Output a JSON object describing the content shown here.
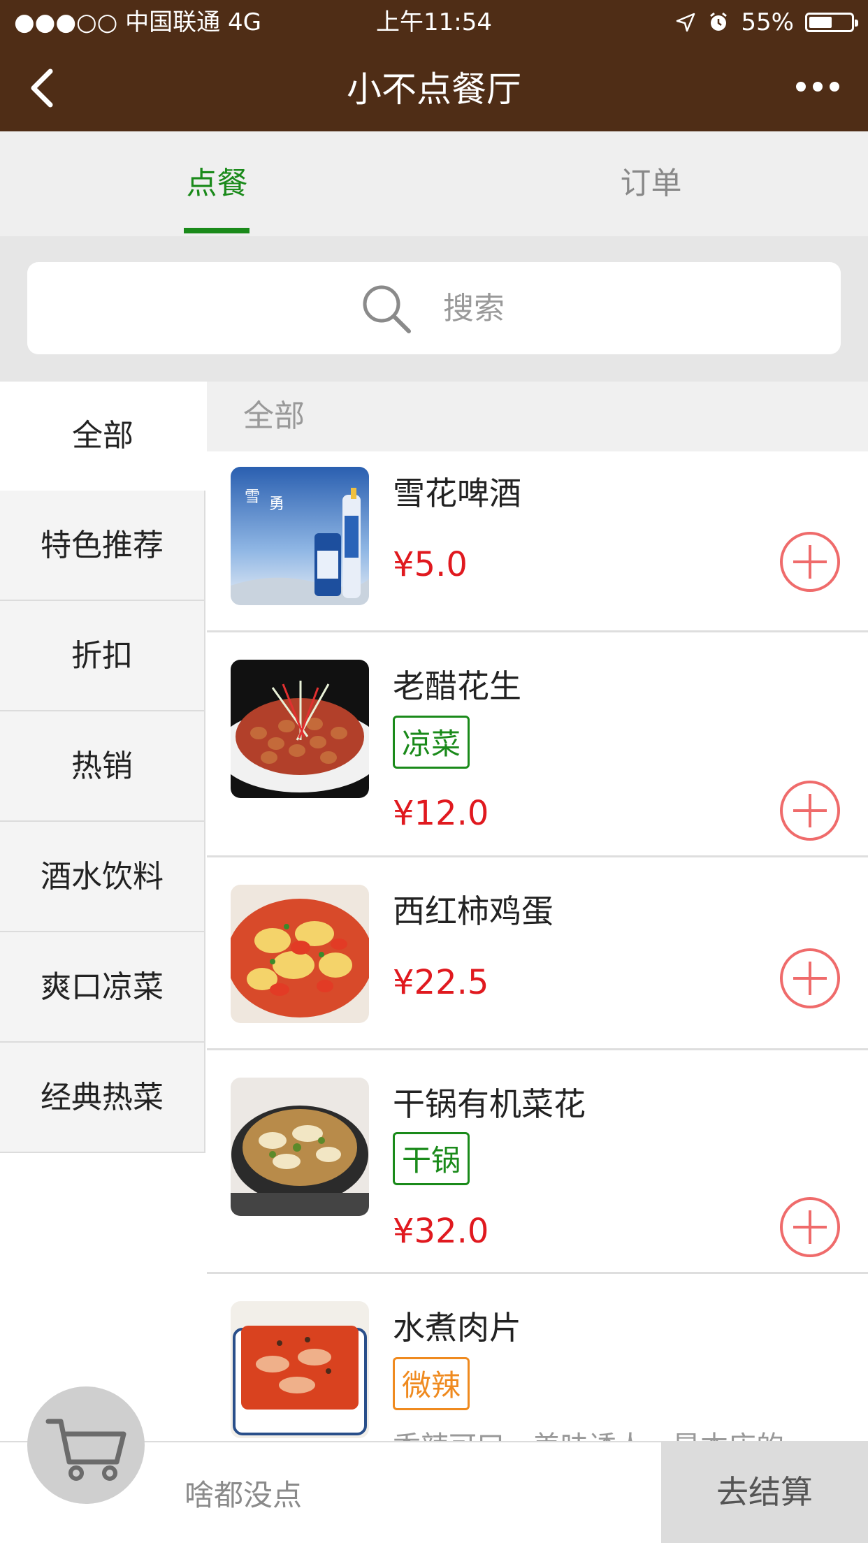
{
  "status_bar": {
    "carrier": "●●●○○ 中国联通   4G",
    "time": "上午11:54",
    "battery": "55%",
    "battery_level": 0.55
  },
  "nav": {
    "title": "小不点餐厅",
    "back_icon": "chevron-left-icon",
    "more_icon": "more-dots-icon"
  },
  "tabs": [
    {
      "label": "点餐",
      "active": true
    },
    {
      "label": "订单",
      "active": false
    }
  ],
  "search": {
    "placeholder": "搜索",
    "icon": "search-icon"
  },
  "categories": [
    {
      "label": "全部",
      "active": true
    },
    {
      "label": "特色推荐"
    },
    {
      "label": "折扣"
    },
    {
      "label": "热销"
    },
    {
      "label": "酒水饮料"
    },
    {
      "label": "爽口凉菜"
    },
    {
      "label": "经典热菜"
    }
  ],
  "list": {
    "section_title": "全部",
    "dishes": [
      {
        "name": "雪花啤酒",
        "price": "¥5.0",
        "tag": ""
      },
      {
        "name": "老醋花生",
        "price": "¥12.0",
        "tag": "凉菜"
      },
      {
        "name": "西红柿鸡蛋",
        "price": "¥22.5",
        "tag": ""
      },
      {
        "name": "干锅有机菜花",
        "price": "¥32.0",
        "tag": "干锅"
      },
      {
        "name": "水煮肉片",
        "price": "",
        "tag": "微辣",
        "desc": "香辣可口，美味诱人，是本店的"
      }
    ]
  },
  "bottom": {
    "empty_text": "啥都没点",
    "checkout_label": "去结算",
    "cart_icon": "cart-icon"
  },
  "colors": {
    "nav_bg": "#4f2d16",
    "accent_green": "#1a8a1a",
    "price_red": "#e0191f",
    "tag_orange": "#ef8a1f"
  }
}
